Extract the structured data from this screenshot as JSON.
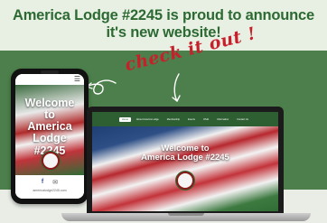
{
  "announcement": {
    "line1": "America Lodge #2245 is proud to announce",
    "line2": "it's new website!",
    "call_to_action": "check it out !"
  },
  "phone": {
    "hero_title_lines": [
      "Welcome",
      "to",
      "America",
      "Lodge",
      "#2245"
    ],
    "menu_icon": "☰",
    "footer_icons": [
      "facebook-icon",
      "mail-icon"
    ],
    "facebook_glyph": "f",
    "mail_glyph": "✉",
    "url": "americalodge2245.com"
  },
  "laptop": {
    "nav_items": [
      "Home",
      "About America Lodge",
      "Membership",
      "Events",
      "OSIA",
      "Information",
      "Contact Us"
    ],
    "hero_title_line1": "Welcome to",
    "hero_title_line2": "America Lodge #2245"
  },
  "colors": {
    "board_green": "#4c7f4b",
    "headline_green": "#2d6a33",
    "cta_red": "#c8202b",
    "site_nav_green": "#2e5f33"
  }
}
